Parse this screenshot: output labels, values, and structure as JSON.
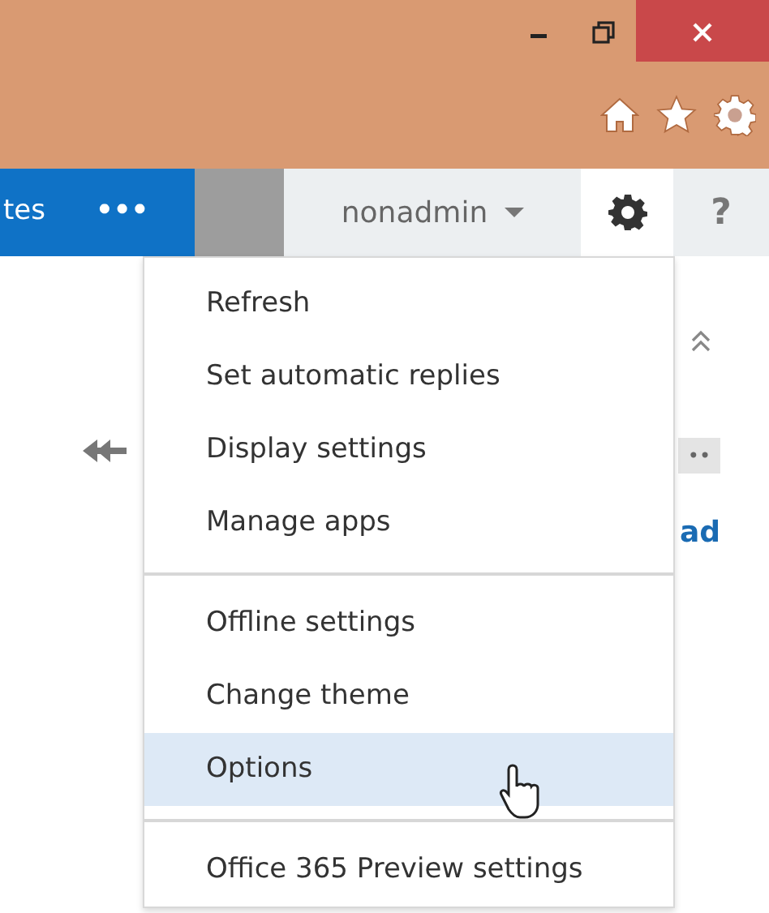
{
  "nav": {
    "app_text": "tes",
    "more": "•••",
    "user": "nonadmin",
    "help": "?"
  },
  "background": {
    "tag_text": "••",
    "link_text": "ad"
  },
  "menu": {
    "groups": [
      [
        {
          "label": "Refresh",
          "selected": false
        },
        {
          "label": "Set automatic replies",
          "selected": false
        },
        {
          "label": "Display settings",
          "selected": false
        },
        {
          "label": "Manage apps",
          "selected": false
        }
      ],
      [
        {
          "label": "Offline settings",
          "selected": false
        },
        {
          "label": "Change theme",
          "selected": false
        },
        {
          "label": "Options",
          "selected": true
        }
      ],
      [
        {
          "label": "Office 365 Preview settings",
          "selected": false
        }
      ]
    ]
  }
}
